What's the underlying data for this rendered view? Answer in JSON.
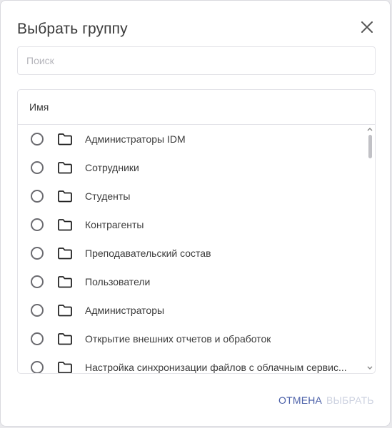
{
  "dialog": {
    "title": "Выбрать группу",
    "close_icon": "close-icon"
  },
  "search": {
    "placeholder": "Поиск",
    "value": ""
  },
  "table": {
    "column_header": "Имя",
    "rows": [
      {
        "label": "Администраторы IDM",
        "selected": false
      },
      {
        "label": "Сотрудники",
        "selected": false
      },
      {
        "label": "Студенты",
        "selected": false
      },
      {
        "label": "Контрагенты",
        "selected": false
      },
      {
        "label": "Преподавательский состав",
        "selected": false
      },
      {
        "label": "Пользователи",
        "selected": false
      },
      {
        "label": "Администраторы",
        "selected": false
      },
      {
        "label": "Открытие внешних отчетов и обработок",
        "selected": false
      },
      {
        "label": "Настройка синхронизации файлов с облачным сервис...",
        "selected": false
      }
    ],
    "row_icons": {
      "radio": "radio-unchecked",
      "folder": "folder-icon"
    }
  },
  "footer": {
    "cancel_label": "ОТМЕНА",
    "select_label": "ВЫБРАТЬ"
  },
  "colors": {
    "accent": "#4a5fa8",
    "disabled": "#cdd2e0",
    "border": "#e3e3e8"
  }
}
